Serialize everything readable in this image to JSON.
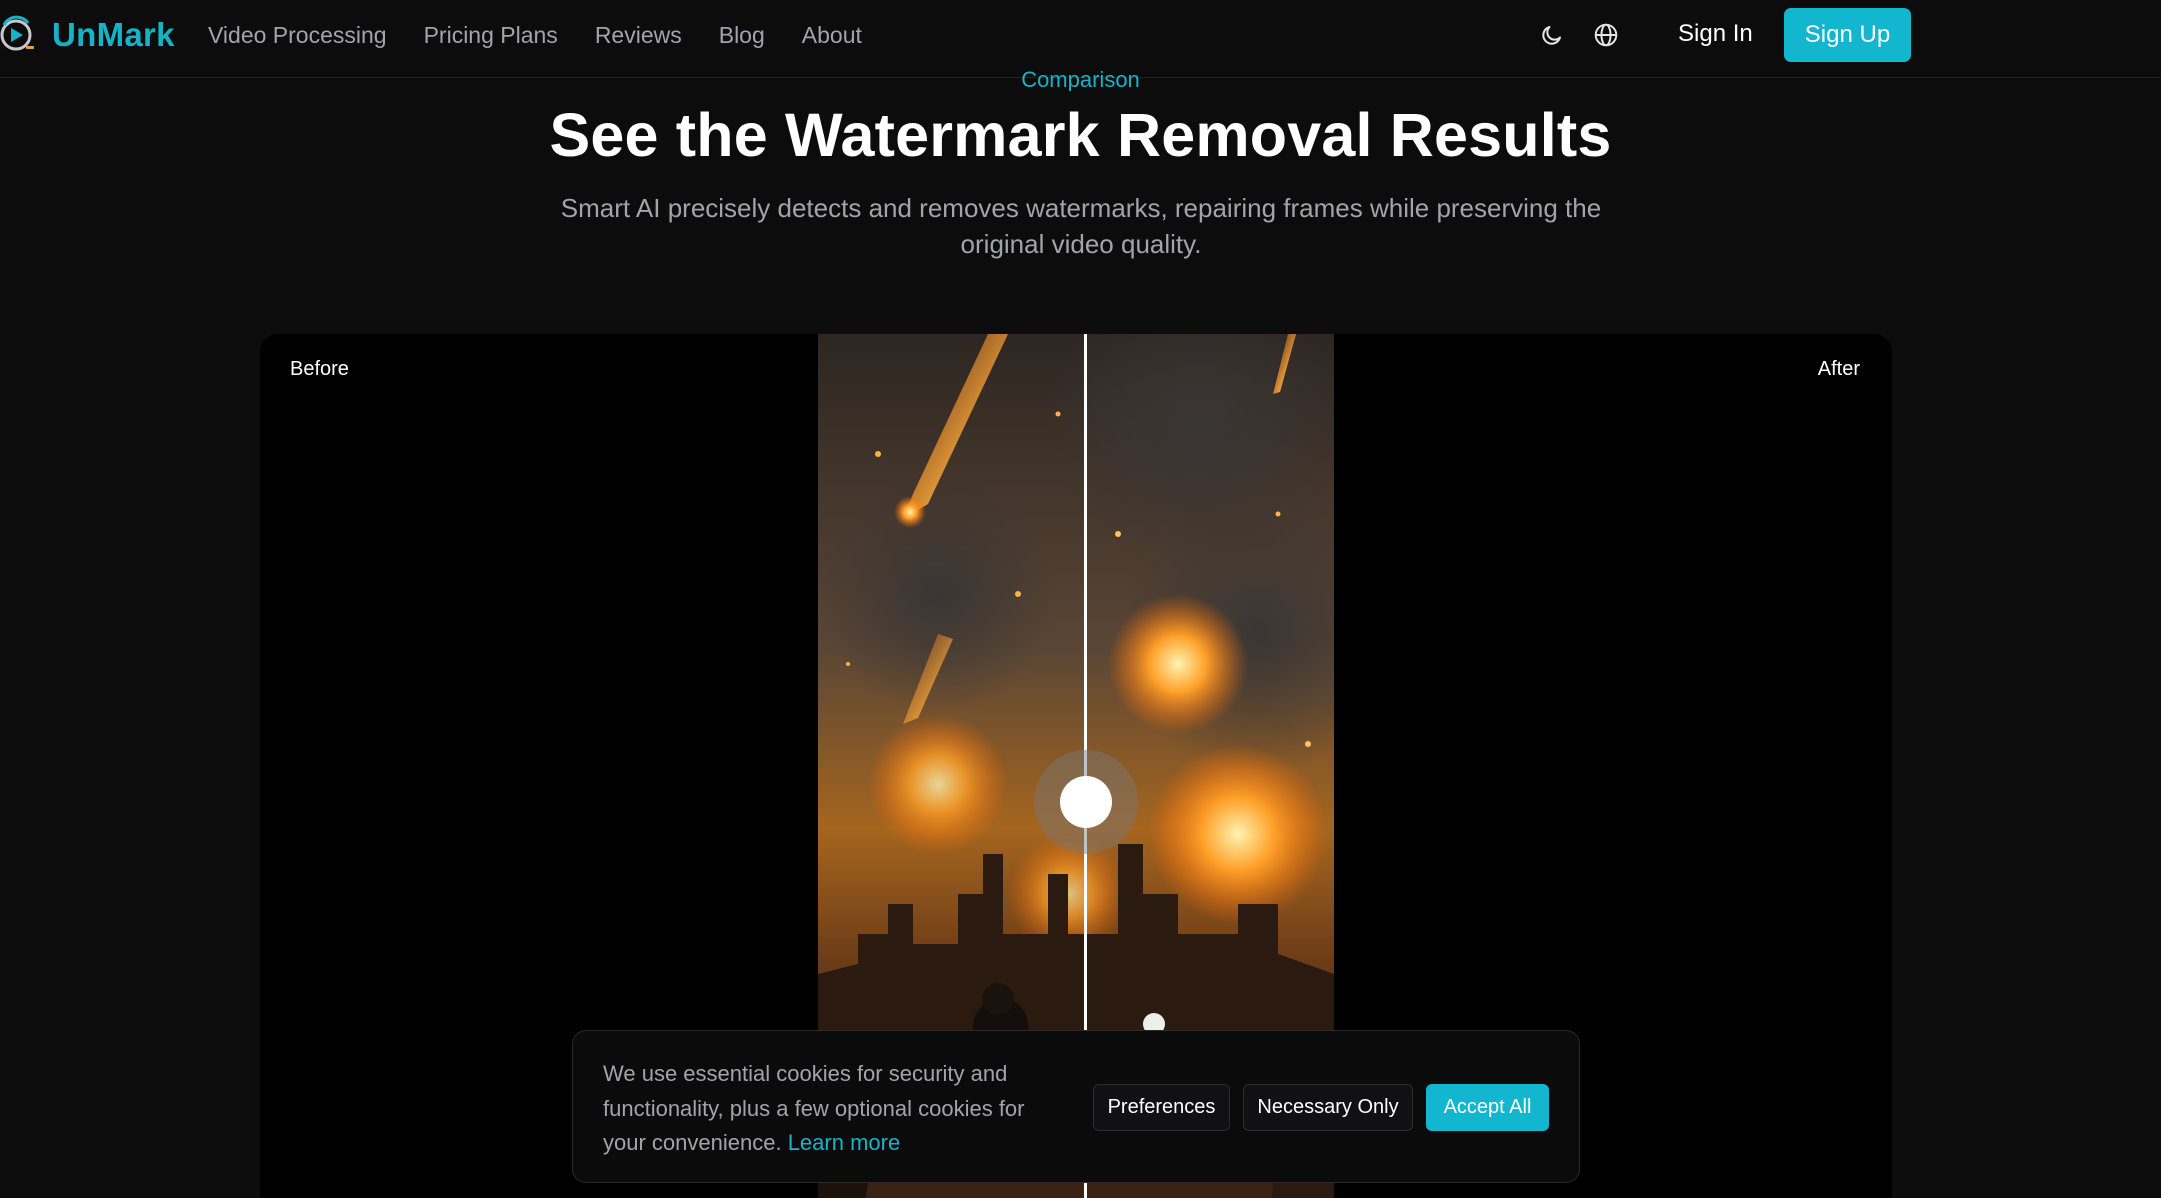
{
  "header": {
    "brand": "UnMark",
    "nav": [
      "Video Processing",
      "Pricing Plans",
      "Reviews",
      "Blog",
      "About"
    ],
    "theme_icon": "moon-icon",
    "language_icon": "globe-icon",
    "sign_in": "Sign In",
    "sign_up": "Sign Up"
  },
  "hero": {
    "eyebrow": "Comparison",
    "title": "See the Watermark Removal Results",
    "subtitle": "Smart AI precisely detects and removes watermarks, repairing frames while preserving the original video quality."
  },
  "comparison": {
    "before_label": "Before",
    "after_label": "After"
  },
  "cookie": {
    "text": "We use essential cookies for security and functionality, plus a few optional cookies for your convenience.",
    "link": "Learn more",
    "preferences": "Preferences",
    "necessary_only": "Necessary Only",
    "accept_all": "Accept All"
  },
  "colors": {
    "accent": "#12b6cf",
    "background": "#0c0c0d",
    "muted_text": "#a3a3aa"
  }
}
